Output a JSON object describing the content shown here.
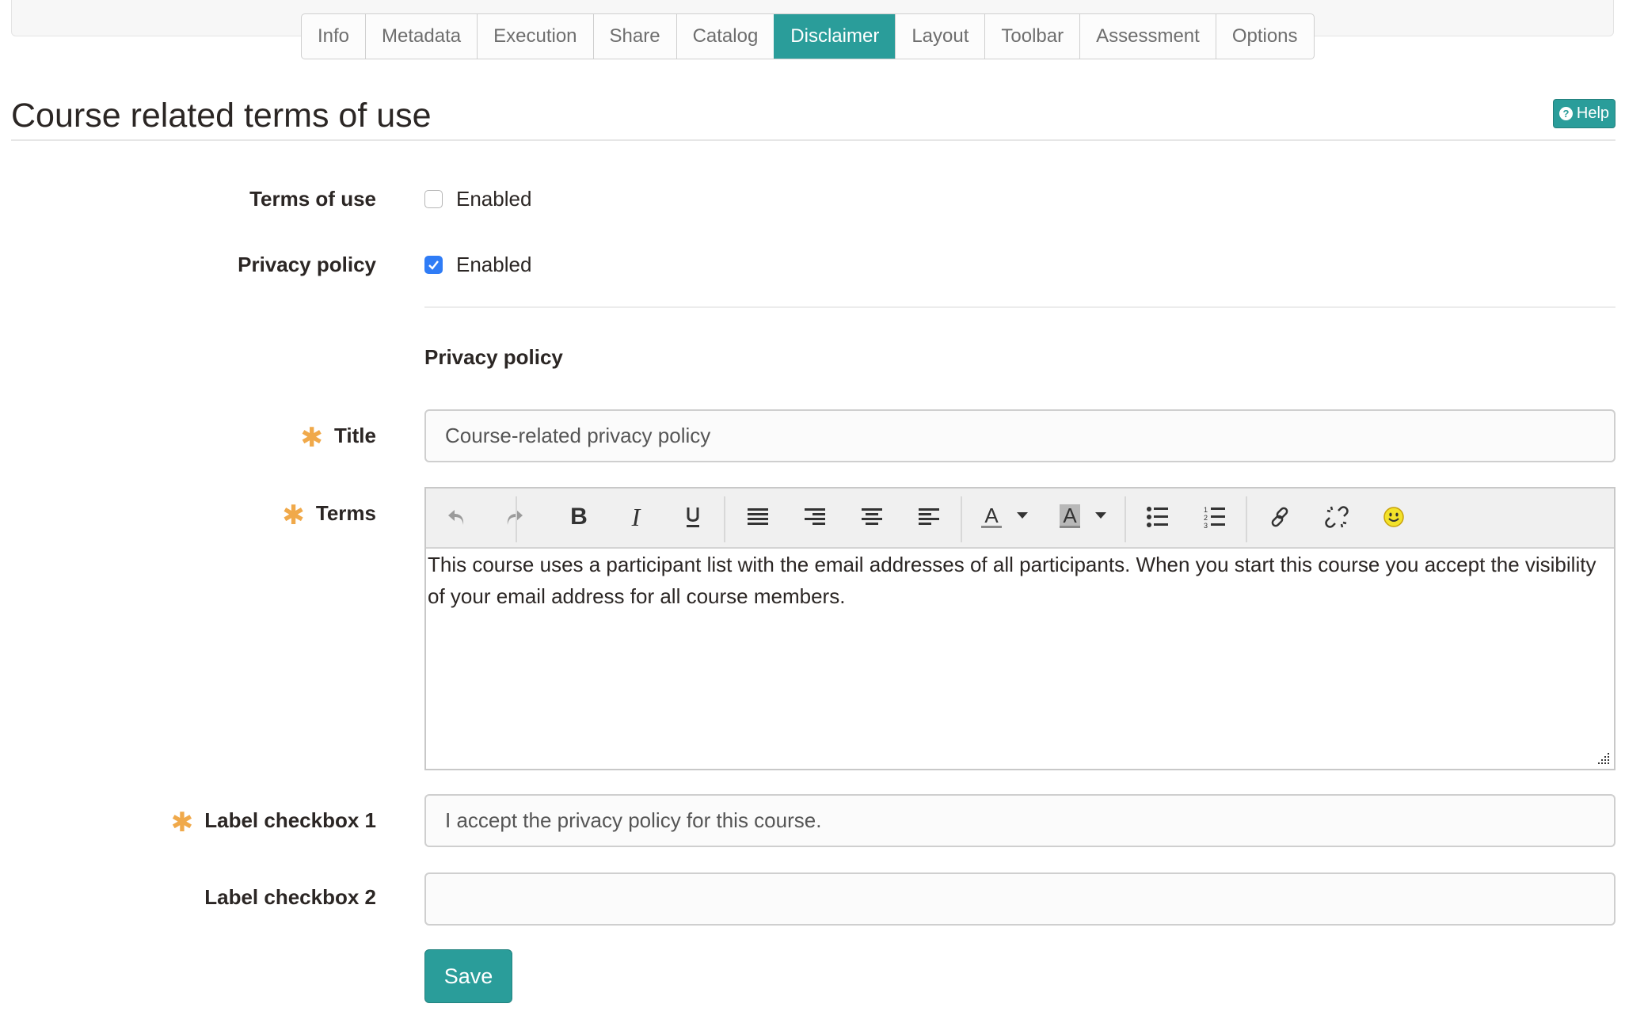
{
  "tabs": [
    {
      "label": "Info",
      "active": false
    },
    {
      "label": "Metadata",
      "active": false
    },
    {
      "label": "Execution",
      "active": false
    },
    {
      "label": "Share",
      "active": false
    },
    {
      "label": "Catalog",
      "active": false
    },
    {
      "label": "Disclaimer",
      "active": true
    },
    {
      "label": "Layout",
      "active": false
    },
    {
      "label": "Toolbar",
      "active": false
    },
    {
      "label": "Assessment",
      "active": false
    },
    {
      "label": "Options",
      "active": false
    }
  ],
  "header": {
    "title": "Course related terms of use",
    "help_label": "Help",
    "help_icon": "question-circle-icon"
  },
  "form": {
    "terms_of_use": {
      "label": "Terms of use",
      "option_label": "Enabled",
      "checked": false
    },
    "privacy_policy": {
      "label": "Privacy policy",
      "option_label": "Enabled",
      "checked": true
    },
    "section_heading": "Privacy policy",
    "title": {
      "label": "Title",
      "required": true,
      "value": "Course-related privacy policy"
    },
    "terms": {
      "label": "Terms",
      "required": true,
      "content": "This course uses a participant list with the email addresses of all participants. When you start this course you accept the visibility of your email address for all course members.",
      "toolbar": [
        {
          "name": "undo",
          "icon": "undo-icon"
        },
        {
          "name": "redo",
          "icon": "redo-icon"
        },
        {
          "name": "bold",
          "icon": "bold-icon"
        },
        {
          "name": "italic",
          "icon": "italic-icon"
        },
        {
          "name": "underline",
          "icon": "underline-icon"
        },
        {
          "name": "align-justify",
          "icon": "align-justify-icon"
        },
        {
          "name": "align-right",
          "icon": "align-right-icon"
        },
        {
          "name": "align-center",
          "icon": "align-center-icon"
        },
        {
          "name": "align-left",
          "icon": "align-left-icon"
        },
        {
          "name": "text-color",
          "icon": "text-color-icon"
        },
        {
          "name": "background-color",
          "icon": "background-color-icon"
        },
        {
          "name": "bullet-list",
          "icon": "bullet-list-icon"
        },
        {
          "name": "numbered-list",
          "icon": "numbered-list-icon"
        },
        {
          "name": "link",
          "icon": "link-icon"
        },
        {
          "name": "unlink",
          "icon": "unlink-icon"
        },
        {
          "name": "emoticons",
          "icon": "smiley-icon"
        }
      ]
    },
    "label_checkbox_1": {
      "label": "Label checkbox 1",
      "required": true,
      "value": "I accept the privacy policy for this course."
    },
    "label_checkbox_2": {
      "label": "Label checkbox 2",
      "required": false,
      "value": ""
    },
    "save_label": "Save"
  },
  "colors": {
    "accent": "#2a9d9a",
    "required": "#f0a94a",
    "checkbox_checked": "#2f7cf6"
  }
}
